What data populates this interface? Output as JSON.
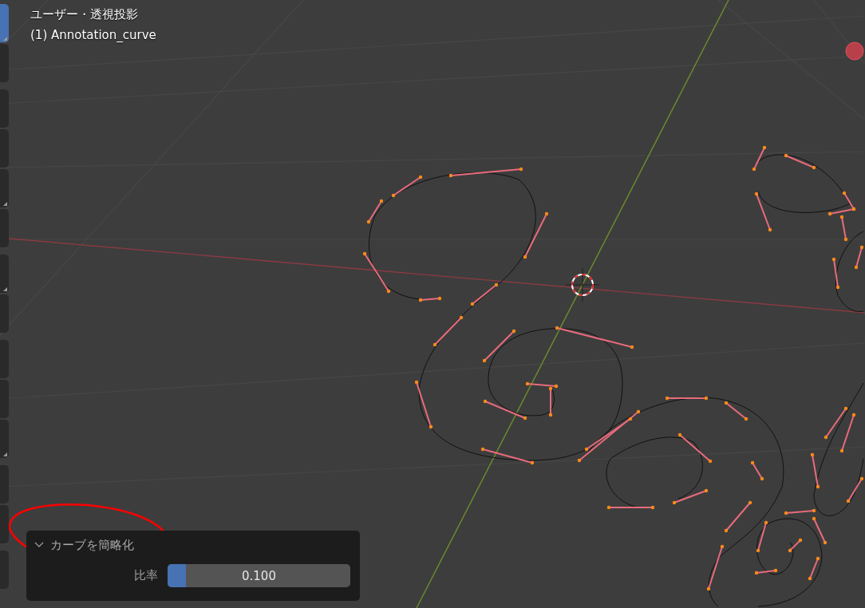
{
  "viewport": {
    "view_name": "ユーザー・透視投影",
    "object_name": "(1) Annotation_curve"
  },
  "toolbar": {
    "groups": [
      {
        "buttons": [
          {
            "selected": true,
            "has_submenu": true
          },
          {
            "selected": false,
            "has_submenu": false
          }
        ]
      },
      {
        "buttons": [
          {
            "selected": false,
            "has_submenu": false
          },
          {
            "selected": false,
            "has_submenu": false
          },
          {
            "selected": false,
            "has_submenu": true
          },
          {
            "selected": false,
            "has_submenu": false
          }
        ]
      },
      {
        "buttons": [
          {
            "selected": false,
            "has_submenu": true
          },
          {
            "selected": false,
            "has_submenu": false
          }
        ]
      },
      {
        "buttons": [
          {
            "selected": false,
            "has_submenu": false
          },
          {
            "selected": false,
            "has_submenu": false
          },
          {
            "selected": false,
            "has_submenu": true
          }
        ]
      },
      {
        "buttons": [
          {
            "selected": false,
            "has_submenu": false
          },
          {
            "selected": false,
            "has_submenu": false
          }
        ]
      },
      {
        "buttons": [
          {
            "selected": false,
            "has_submenu": false
          }
        ]
      }
    ]
  },
  "operator_panel": {
    "title": "カーブを簡略化",
    "expanded": true,
    "fields": [
      {
        "label": "比率",
        "value": "0.100",
        "level": 0.1
      }
    ]
  }
}
